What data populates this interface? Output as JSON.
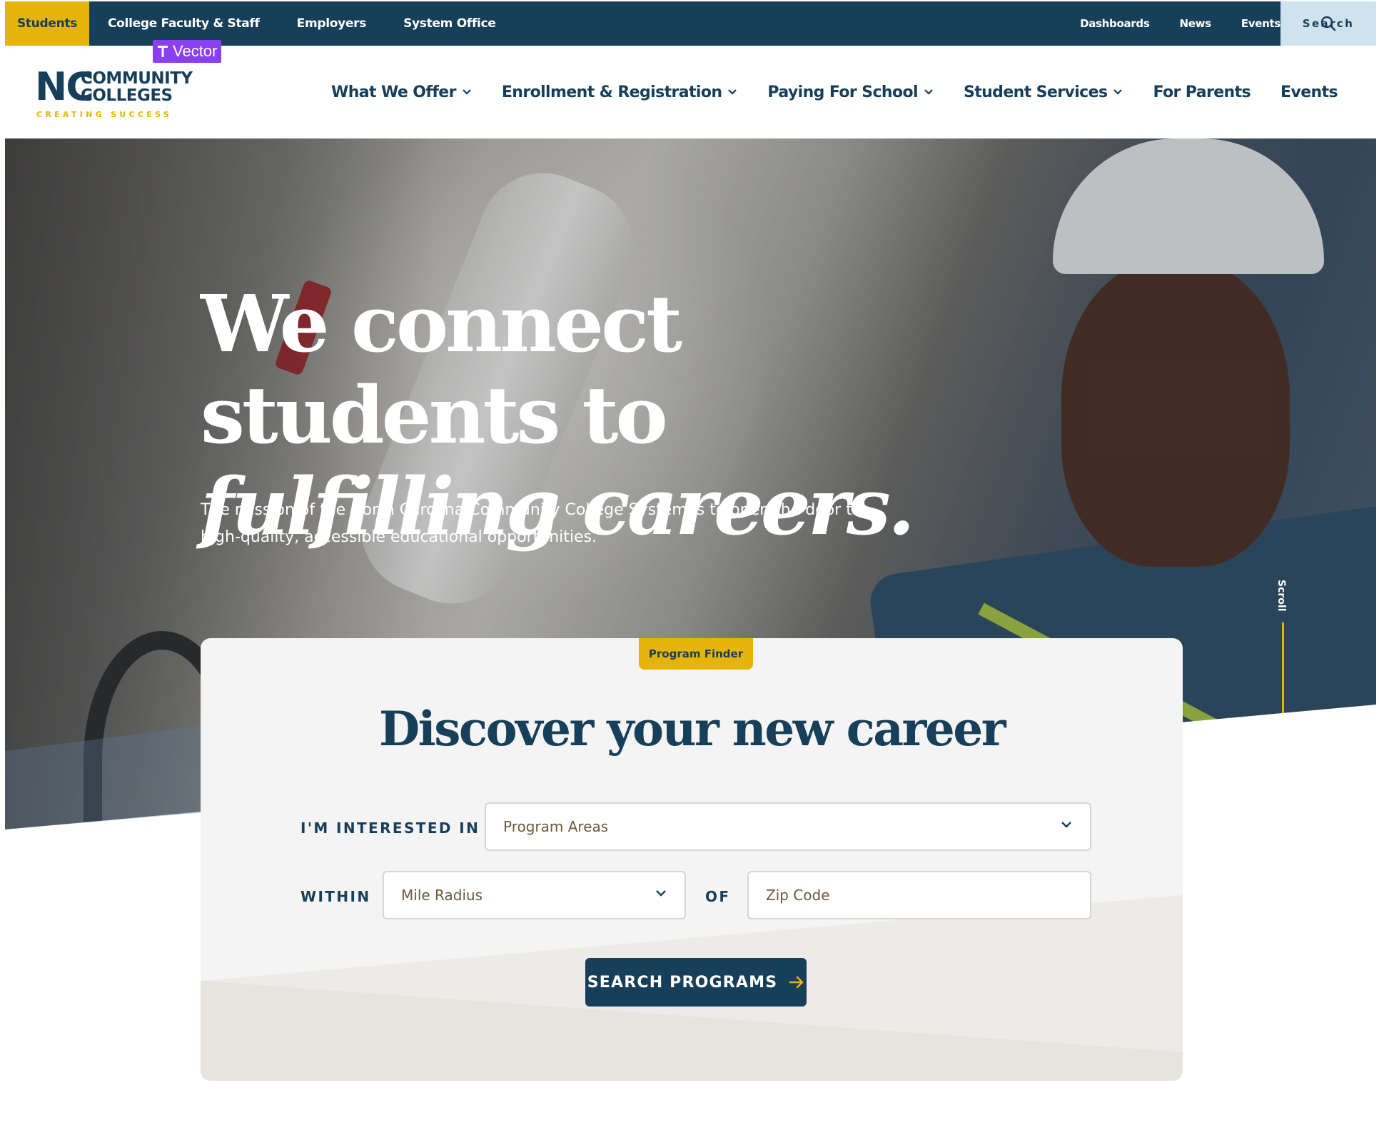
{
  "utility_nav": {
    "students": "Students",
    "left_items": [
      "College Faculty & Staff",
      "Employers",
      "System Office"
    ],
    "right_items": [
      "Dashboards",
      "News",
      "Events"
    ],
    "search_label": "Search"
  },
  "logo": {
    "nc": "NC",
    "line1": "COMMUNITY",
    "line2": "COLLEGES",
    "tagline": "CREATING SUCCESS"
  },
  "overlay_tag": "Vector",
  "main_nav": {
    "items": [
      {
        "label": "What We Offer",
        "has_dropdown": true
      },
      {
        "label": "Enrollment & Registration",
        "has_dropdown": true
      },
      {
        "label": "Paying For School",
        "has_dropdown": true
      },
      {
        "label": "Student Services",
        "has_dropdown": true
      },
      {
        "label": "For Parents",
        "has_dropdown": false
      },
      {
        "label": "Events",
        "has_dropdown": false
      }
    ]
  },
  "hero": {
    "title_line1": "We connect students to",
    "title_line2": "fulfilling careers.",
    "subtitle": "The mission of the North Carolina Community College System is to open the door to high-quality, accessible educational opportunities.",
    "scroll_label": "Scroll"
  },
  "program_finder": {
    "badge": "Program Finder",
    "title": "Discover your new career",
    "interested_label": "I'M INTERESTED IN",
    "program_areas_placeholder": "Program Areas",
    "within_label": "WITHIN",
    "mile_radius_placeholder": "Mile Radius",
    "of_label": "OF",
    "zip_placeholder": "Zip Code",
    "button_label": "SEARCH PROGRAMS"
  },
  "colors": {
    "navy": "#173f5a",
    "gold": "#e4b40b",
    "light_blue": "#cfe3ef",
    "card_bg": "#f4f4f4"
  }
}
